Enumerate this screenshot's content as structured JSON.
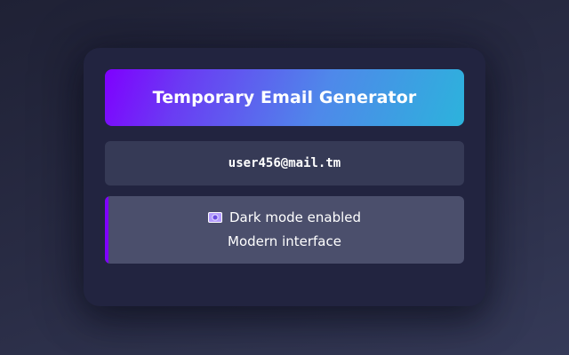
{
  "app": {
    "title": "Temporary Email Generator"
  },
  "email": {
    "address": "user456@mail.tm"
  },
  "info": {
    "icon": "dark-mode-icon",
    "line1": "Dark mode enabled",
    "line2": "Modern interface"
  },
  "colors": {
    "accent": "#7f00ff",
    "gradient_start": "#7f00ff",
    "gradient_end": "#2cb3dc",
    "card_bg": "#222440"
  }
}
